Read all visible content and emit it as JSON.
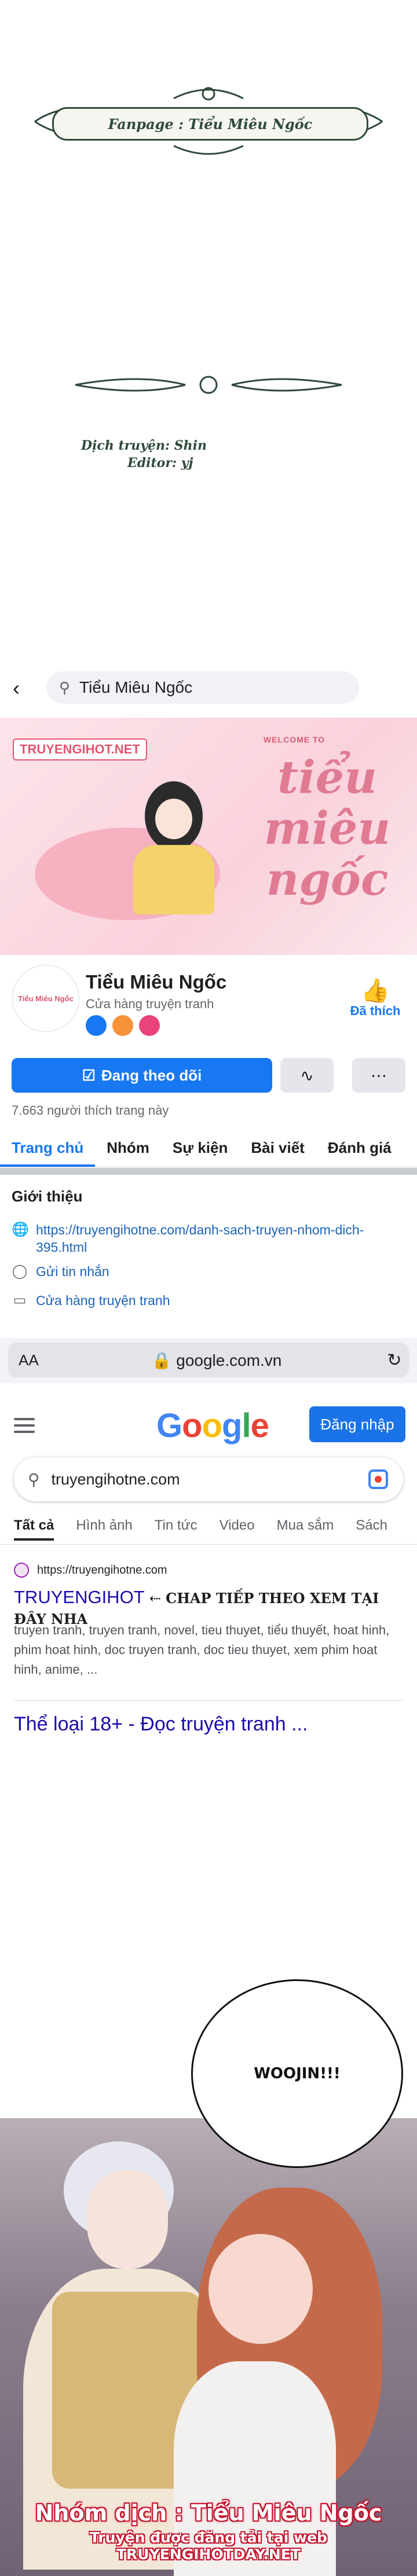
{
  "credits": {
    "fanpage": "Fanpage : Tiểu Miêu Ngốc",
    "translator": "Dịch truyện: Shin",
    "editor": "Editor: yj"
  },
  "facebook": {
    "search_text": "Tiểu Miêu Ngốc",
    "cover_watermark": "TRUYENGIHOT.NET",
    "cover_welcome": "WELCOME TO",
    "cover_script": "tiểu miêu ngốc",
    "page_name": "Tiểu Miêu Ngốc",
    "category": "Cửa hàng truyện tranh",
    "liked_label": "Đã thích",
    "follow_label": "Đang theo dõi",
    "likes_count": "7.663 người thích trang này",
    "tabs": [
      "Trang chủ",
      "Nhóm",
      "Sự kiện",
      "Bài viết",
      "Đánh giá"
    ],
    "intro_title": "Giới thiệu",
    "intro_link": "https://truyengihotne.com/danh-sach-truyen-nhom-dich-395.html",
    "intro_message": "Gửi tin nhắn",
    "intro_category": "Cửa hàng truyện tranh"
  },
  "browser": {
    "aa_label": "AA",
    "url": "google.com.vn"
  },
  "google": {
    "logo": "Google",
    "signin": "Đăng nhập",
    "query": "truyengihotne.com",
    "tabs": [
      "Tất cả",
      "Hình ảnh",
      "Tin tức",
      "Video",
      "Mua sắm",
      "Sách"
    ],
    "result_source": "https://truyengihotne.com",
    "result_title": "TRUYENGIHOT",
    "result_title_note": "⇠ CHAP TIẾP THEO XEM TẠI ĐÂY NHA",
    "result_snippet": "truyen tranh, truyen tranh, novel, tieu thuyet, tiểu thuyết, hoat hinh, phim hoat hinh, doc truyen tranh, doc tieu thuyet, xem phim hoat hinh, anime, ...",
    "result_link2": "Thể loại 18+ - Đọc truyện tranh ..."
  },
  "comic": {
    "bubble": "WOOJIN!!!",
    "group_credit": "Nhóm dịch : Tiểu Miêu Ngốc",
    "site_credit": "Truyện được đăng tải tại web TRUYENGIHOTDAY.NET"
  }
}
